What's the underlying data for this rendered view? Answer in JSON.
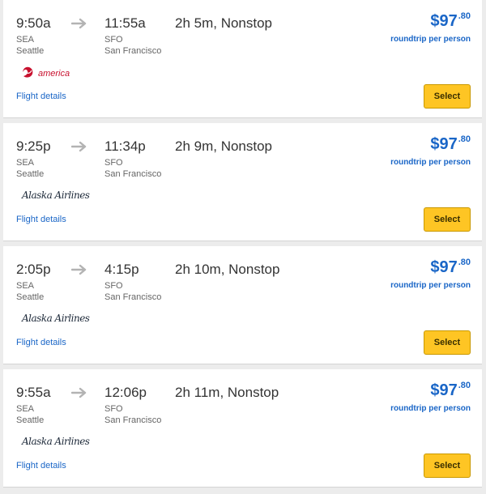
{
  "colors": {
    "link": "#1a66c7",
    "select_button": "#fec524",
    "virgin_red": "#c8102e"
  },
  "flights": [
    {
      "depart_time": "9:50a",
      "depart_code": "SEA",
      "depart_city": "Seattle",
      "arrive_time": "11:55a",
      "arrive_code": "SFO",
      "arrive_city": "San Francisco",
      "duration": "2h 5m, Nonstop",
      "price_main": "$97",
      "price_cents": ".80",
      "price_note": "roundtrip per person",
      "airline_logo": "virgin-america-logo",
      "airline_logo_text": "america",
      "details_label": "Flight details",
      "select_label": "Select"
    },
    {
      "depart_time": "9:25p",
      "depart_code": "SEA",
      "depart_city": "Seattle",
      "arrive_time": "11:34p",
      "arrive_code": "SFO",
      "arrive_city": "San Francisco",
      "duration": "2h 9m, Nonstop",
      "price_main": "$97",
      "price_cents": ".80",
      "price_note": "roundtrip per person",
      "airline_logo": "alaska-airlines-logo",
      "airline_logo_text": "Alaska Airlines",
      "details_label": "Flight details",
      "select_label": "Select"
    },
    {
      "depart_time": "2:05p",
      "depart_code": "SEA",
      "depart_city": "Seattle",
      "arrive_time": "4:15p",
      "arrive_code": "SFO",
      "arrive_city": "San Francisco",
      "duration": "2h 10m, Nonstop",
      "price_main": "$97",
      "price_cents": ".80",
      "price_note": "roundtrip per person",
      "airline_logo": "alaska-airlines-logo",
      "airline_logo_text": "Alaska Airlines",
      "details_label": "Flight details",
      "select_label": "Select"
    },
    {
      "depart_time": "9:55a",
      "depart_code": "SEA",
      "depart_city": "Seattle",
      "arrive_time": "12:06p",
      "arrive_code": "SFO",
      "arrive_city": "San Francisco",
      "duration": "2h 11m, Nonstop",
      "price_main": "$97",
      "price_cents": ".80",
      "price_note": "roundtrip per person",
      "airline_logo": "alaska-airlines-logo",
      "airline_logo_text": "Alaska Airlines",
      "details_label": "Flight details",
      "select_label": "Select"
    }
  ]
}
